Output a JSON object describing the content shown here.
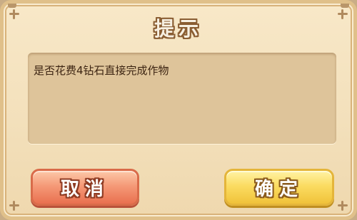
{
  "dialog": {
    "title": "提示",
    "message": "是否花费4钻石直接完成作物",
    "cancel_label": "取消",
    "confirm_label": "确定"
  },
  "colors": {
    "panel_background": "#f3e0bb",
    "message_box": "#dec49a",
    "cancel_button": "#f59a78",
    "confirm_button": "#fbdc62",
    "title_outline": "#8a5d32"
  }
}
